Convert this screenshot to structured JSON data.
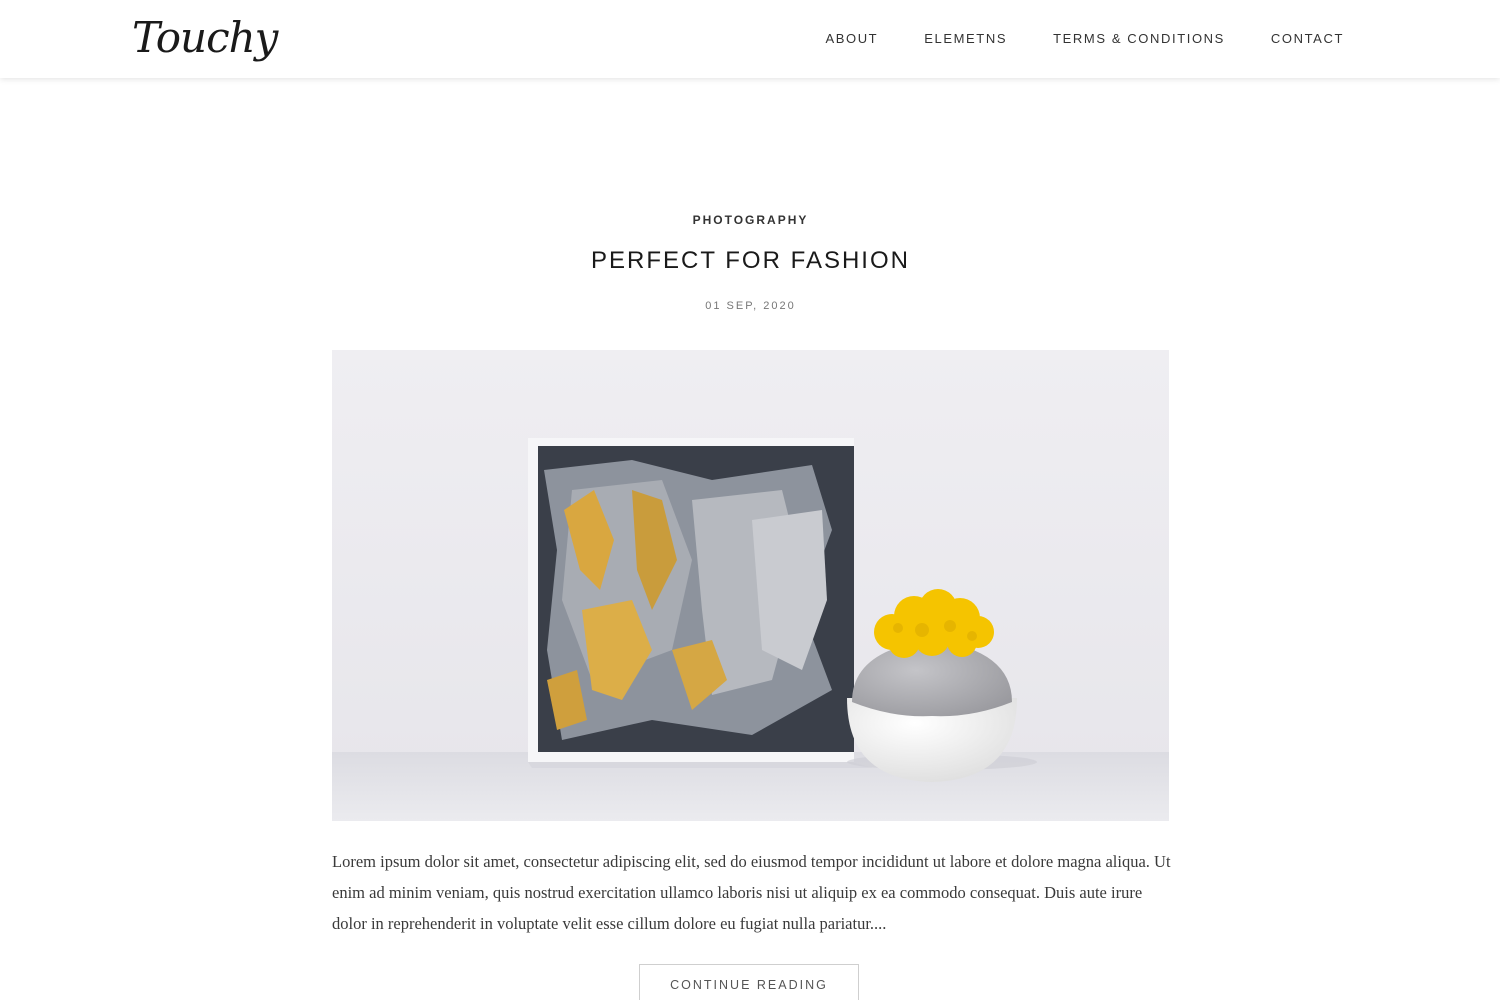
{
  "header": {
    "logo": "Touchy",
    "nav": [
      {
        "label": "ABOUT"
      },
      {
        "label": "ELEMETNS"
      },
      {
        "label": "TERMS & CONDITIONS"
      },
      {
        "label": "CONTACT"
      }
    ]
  },
  "post": {
    "category": "PHOTOGRAPHY",
    "title": "PERFECT FOR FASHION",
    "date": "01 SEP, 2020",
    "excerpt": "Lorem ipsum dolor sit amet, consectetur adipiscing elit, sed do eiusmod tempor incididunt ut labore et dolore magna aliqua. Ut enim ad minim veniam, quis nostrud exercitation ullamco laboris nisi ut aliquip ex ea commodo consequat. Duis aute irure dolor in reprehenderit in voluptate velit esse cillum dolore eu fugiat nulla pariatur....",
    "button": "CONTINUE READING"
  },
  "colors": {
    "accent_yellow": "#f5c400",
    "text_dark": "#1a1a1a",
    "text_muted": "#777777",
    "border": "#cfcfcf"
  }
}
